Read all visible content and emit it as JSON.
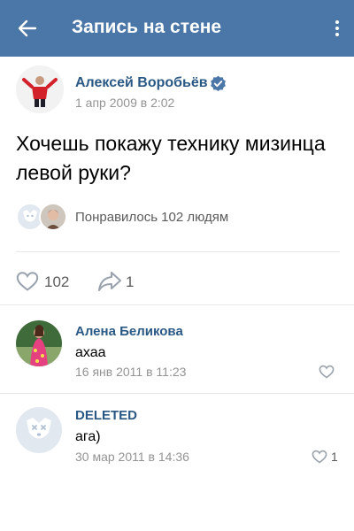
{
  "header": {
    "title": "Запись на стене",
    "background": "#4a76a8"
  },
  "post": {
    "author_name": "Алексей Воробьёв",
    "verified": true,
    "date": "1 апр 2009 в 2:02",
    "text": "Хочешь покажу технику мизинца левой руки?",
    "likes_summary": "Понравилось 102 людям",
    "like_count": "102",
    "share_count": "1"
  },
  "comments": [
    {
      "author": "Алена Беликова",
      "text": "ахаа",
      "date": "16 янв 2011 в 11:23",
      "likes": ""
    },
    {
      "author": "DELETED",
      "text": "ага)",
      "date": "30 мар 2011 в 14:36",
      "likes": "1"
    }
  ],
  "colors": {
    "link": "#2a5885",
    "secondary": "#939393",
    "icon": "#99a2ad"
  }
}
